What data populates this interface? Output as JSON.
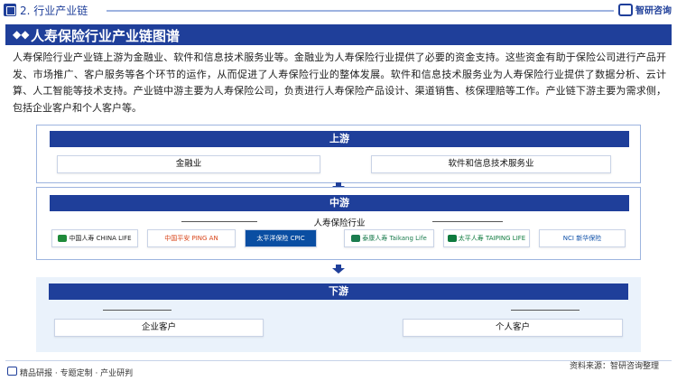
{
  "header": {
    "section_title": "2. 行业产业链",
    "brand": "智研咨询"
  },
  "banner": {
    "title": "人寿保险行业产业链图谱"
  },
  "intro": {
    "text": "人寿保险行业产业链上游为金融业、软件和信息技术服务业等。金融业为人寿保险行业提供了必要的资金支持。这些资金有助于保险公司进行产品开发、市场推广、客户服务等各个环节的运作，从而促进了人寿保险行业的整体发展。软件和信息技术服务业为人寿保险行业提供了数据分析、云计算、人工智能等技术支持。产业链中游主要为人寿保险公司，负责进行人寿保险产品设计、渠道销售、核保理赔等工作。产业链下游主要为需求侧，包括企业客户和个人客户等。"
  },
  "upstream": {
    "title": "上游",
    "items": [
      "金融业",
      "软件和信息技术服务业"
    ]
  },
  "midstream": {
    "title": "中游",
    "subtitle": "人寿保险行业",
    "companies": [
      {
        "name": "中国人寿",
        "sub": "CHINA LIFE",
        "color": "#1f8a3a",
        "icon": "china-life-logo"
      },
      {
        "name": "中国平安",
        "sub": "PING AN",
        "color": "#f26a1b",
        "icon": "ping-an-logo"
      },
      {
        "name": "太平洋保险",
        "sub": "CPIC",
        "color": "#0a4ea2",
        "icon": "cpic-logo"
      },
      {
        "name": "泰康人寿",
        "sub": "Taikang Life",
        "color": "#1b7c4f",
        "icon": "taikang-logo"
      },
      {
        "name": "太平人寿",
        "sub": "TAIPING LIFE",
        "color": "#0e7a3e",
        "icon": "taiping-logo"
      },
      {
        "name": "NCI 新华保险",
        "sub": "",
        "color": "#0d4fa8",
        "icon": "nci-logo"
      }
    ]
  },
  "downstream": {
    "title": "下游",
    "items": [
      "企业客户",
      "个人客户"
    ]
  },
  "footer": {
    "left": "精品研报 · 专题定制 · 产业研判",
    "right": "资料来源：智研咨询整理"
  }
}
